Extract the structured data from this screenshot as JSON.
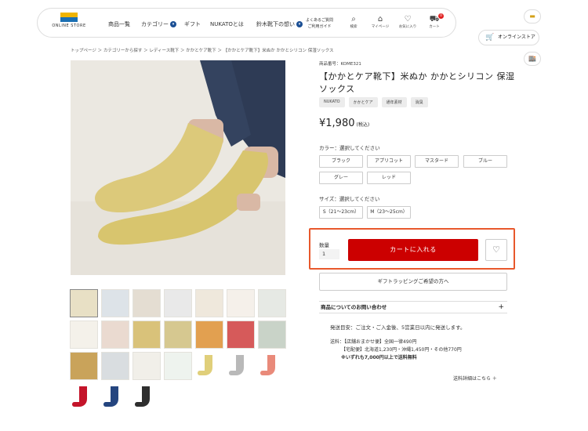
{
  "header": {
    "logo_brand": "鈴木靴下",
    "logo_sub": "ONLINE STORE",
    "nav": [
      {
        "label": "商品一覧"
      },
      {
        "label": "カテゴリー"
      },
      {
        "label": "ギフト"
      },
      {
        "label": "NUKATOとは"
      },
      {
        "label": "鈴木靴下の想い"
      }
    ],
    "faq_line1": "よくあるご質問",
    "faq_line2": "ご利用ガイド",
    "icons": [
      {
        "label": "検索",
        "icon": "search-icon"
      },
      {
        "label": "マイページ",
        "icon": "user-icon"
      },
      {
        "label": "お気に入り",
        "icon": "heart-icon"
      },
      {
        "label": "カート",
        "icon": "cart-icon"
      }
    ],
    "cart_count": "0"
  },
  "side": {
    "online_store": "オンラインストア"
  },
  "breadcrumb": "トップページ ＞ カテゴリーから探す ＞ レディース靴下 ＞ かかとケア靴下 ＞ 【かかとケア靴下】米ぬか かかとシリコン 保湿ソックス",
  "product": {
    "number": "商品番号：KOME321",
    "title": "【かかとケア靴下】米ぬか かかとシリコン 保湿ソックス",
    "tags": [
      "NUKATO",
      "かかとケア",
      "通年素材",
      "消臭"
    ],
    "price": "¥1,980",
    "tax_label": "(税込)",
    "color_label": "カラー：選択してください",
    "colors": [
      "ブラック",
      "アプリコット",
      "マスタード",
      "ブルー",
      "グレー",
      "レッド"
    ],
    "size_label": "サイズ：選択してください",
    "sizes": [
      "S（21〜23cm）",
      "M（23〜25cm）"
    ],
    "qty_label": "数量",
    "qty_value": "1",
    "add_to_cart": "カートに入れる",
    "gift_wrap": "ギフトラッピングご希望の方へ",
    "inquiry": "商品についてのお問い合わせ",
    "inquiry_plus": "+",
    "ship_eta": "発送目安：ご注文・ご入金後、5営業日以内に発送します。",
    "ship_fee_line1": "送料：【店舗おまかせ便】全国一律490円",
    "ship_fee_line2": "【宅配便】北海道1,230円・沖縄1,450円・その他770円",
    "ship_free": "※いずれも7,000円以上で送料無料",
    "ship_detail": "送料詳細はこちら ＋"
  },
  "colors": {
    "accent_red": "#cc0000",
    "highlight_border": "#e8582c",
    "nav_badge": "#1b4f94"
  }
}
